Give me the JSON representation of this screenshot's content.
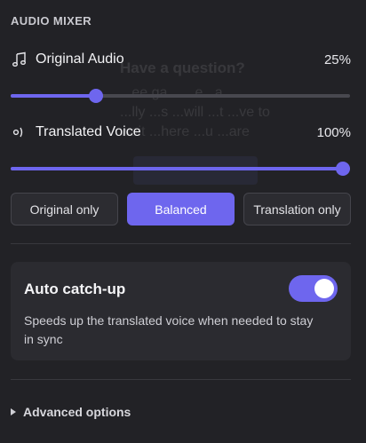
{
  "background_text": {
    "title": "Have a question?",
    "lines": [
      "...ee.ga... ...e...a...",
      "...lly ...s ...will ...t ...ve to",
      "wait ...here ...u ...are"
    ]
  },
  "mixer": {
    "title": "AUDIO MIXER",
    "original": {
      "label": "Original Audio",
      "value_text": "25%",
      "level": 0.25,
      "icon": "music-note-icon"
    },
    "translated": {
      "label": "Translated Voice",
      "value_text": "100%",
      "level": 1.0,
      "icon": "voice-icon"
    },
    "modes": [
      {
        "label": "Original only",
        "selected": false
      },
      {
        "label": "Balanced",
        "selected": true
      },
      {
        "label": "Translation only",
        "selected": false
      }
    ]
  },
  "catchup": {
    "title": "Auto catch-up",
    "description": "Speeds up the translated voice when needed to stay in sync",
    "enabled": true
  },
  "advanced": {
    "label": "Advanced options",
    "icon": "caret-right-icon"
  },
  "colors": {
    "accent": "#6e66ee",
    "background": "#222226",
    "card": "#2b2b30"
  }
}
